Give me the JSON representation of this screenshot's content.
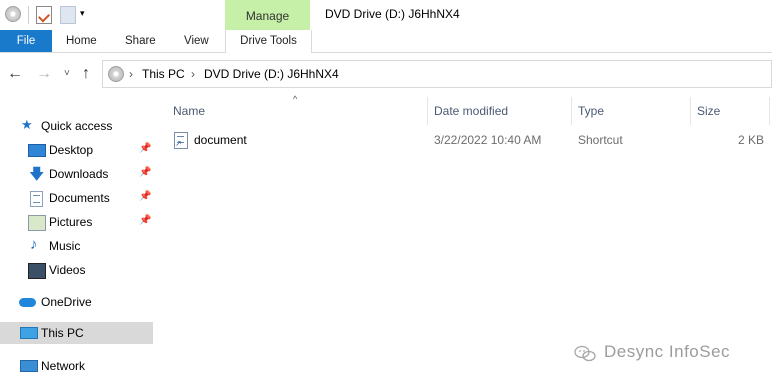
{
  "titlebar": {
    "manage_tab": "Manage",
    "window_title": "DVD Drive (D:) J6HhNX4",
    "quick_access_dropdown": "▾"
  },
  "ribbon": {
    "tabs": [
      {
        "label": "File"
      },
      {
        "label": "Home"
      },
      {
        "label": "Share"
      },
      {
        "label": "View"
      },
      {
        "label": "Drive Tools"
      }
    ]
  },
  "nav": {
    "back": "←",
    "forward": "→",
    "recent": "˅",
    "up": "↑"
  },
  "address": {
    "chevron": "›",
    "crumbs": [
      "This PC",
      "DVD Drive (D:) J6HhNX4"
    ]
  },
  "sidebar": {
    "items": [
      {
        "label": "Quick access",
        "icon": "star-icon"
      },
      {
        "label": "Desktop",
        "icon": "desktop-icon",
        "pinned": true
      },
      {
        "label": "Downloads",
        "icon": "download-icon",
        "pinned": true
      },
      {
        "label": "Documents",
        "icon": "documents-icon",
        "pinned": true
      },
      {
        "label": "Pictures",
        "icon": "pictures-icon",
        "pinned": true
      },
      {
        "label": "Music",
        "icon": "music-icon"
      },
      {
        "label": "Videos",
        "icon": "videos-icon"
      },
      {
        "label": "OneDrive",
        "icon": "onedrive-icon"
      },
      {
        "label": "This PC",
        "icon": "this-pc-icon",
        "selected": true
      },
      {
        "label": "Network",
        "icon": "network-icon"
      }
    ],
    "pin_glyph": "📌"
  },
  "file_list": {
    "sort_indicator": "^",
    "columns": [
      "Name",
      "Date modified",
      "Type",
      "Size"
    ],
    "rows": [
      {
        "name": "document",
        "date_modified": "3/22/2022 10:40 AM",
        "type": "Shortcut",
        "size": "2 KB"
      }
    ]
  },
  "watermark": {
    "text": "Desync InfoSec"
  },
  "colors": {
    "file_tab": "#1979ca",
    "manage_tab": "#c6efa8",
    "selected_item": "#d9d9d9"
  }
}
